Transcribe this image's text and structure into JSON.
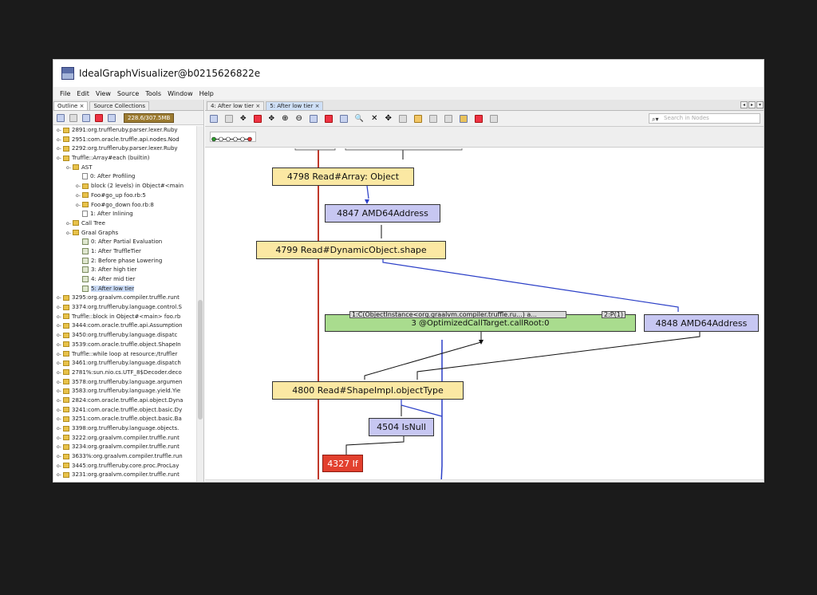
{
  "window": {
    "title": "IdealGraphVisualizer@b0215626822e"
  },
  "menu": [
    "File",
    "Edit",
    "View",
    "Source",
    "Tools",
    "Window",
    "Help"
  ],
  "left_tabs": [
    {
      "label": "Outline",
      "closable": true
    },
    {
      "label": "Source Collections",
      "closable": false
    }
  ],
  "memory": "228.6/307.5MB",
  "tree": [
    {
      "indent": 0,
      "exp": "o-",
      "icon": "folder",
      "label": "2891:org.truffleruby.parser.lexer.Ruby"
    },
    {
      "indent": 0,
      "exp": "o-",
      "icon": "folder",
      "label": "2951:com.oracle.truffle.api.nodes.Nod"
    },
    {
      "indent": 0,
      "exp": "o-",
      "icon": "folder",
      "label": "2292:org.truffleruby.parser.lexer.Ruby"
    },
    {
      "indent": 0,
      "exp": "o-",
      "icon": "folder",
      "label": "Truffle::Array#each (builtin)"
    },
    {
      "indent": 1,
      "exp": "o-",
      "icon": "folder",
      "label": "AST"
    },
    {
      "indent": 2,
      "exp": "",
      "icon": "page",
      "label": "0: After Profiling"
    },
    {
      "indent": 2,
      "exp": "o-",
      "icon": "folder",
      "label": "block (2 levels) in Object#<main"
    },
    {
      "indent": 2,
      "exp": "o-",
      "icon": "folder",
      "label": "Foo#go_up foo.rb:5"
    },
    {
      "indent": 2,
      "exp": "o-",
      "icon": "folder",
      "label": "Foo#go_down foo.rb:8"
    },
    {
      "indent": 2,
      "exp": "",
      "icon": "page",
      "label": "1: After Inlining"
    },
    {
      "indent": 1,
      "exp": "o-",
      "icon": "folder",
      "label": "Call Tree"
    },
    {
      "indent": 1,
      "exp": "o-",
      "icon": "folder",
      "label": "Graal Graphs"
    },
    {
      "indent": 2,
      "exp": "",
      "icon": "graph",
      "label": "0: After Partial Evaluation"
    },
    {
      "indent": 2,
      "exp": "",
      "icon": "graph",
      "label": "1: After TruffleTier"
    },
    {
      "indent": 2,
      "exp": "",
      "icon": "graph",
      "label": "2: Before phase Lowering"
    },
    {
      "indent": 2,
      "exp": "",
      "icon": "graph",
      "label": "3: After high tier"
    },
    {
      "indent": 2,
      "exp": "",
      "icon": "graph",
      "label": "4: After mid tier"
    },
    {
      "indent": 2,
      "exp": "",
      "icon": "graph",
      "label": "5: After low tier",
      "selected": true
    },
    {
      "indent": 0,
      "exp": "o-",
      "icon": "folder",
      "label": "3295:org.graalvm.compiler.truffle.runt"
    },
    {
      "indent": 0,
      "exp": "o-",
      "icon": "folder",
      "label": "3374:org.truffleruby.language.control.S"
    },
    {
      "indent": 0,
      "exp": "o-",
      "icon": "folder",
      "label": "Truffle::block in Object#<main> foo.rb"
    },
    {
      "indent": 0,
      "exp": "o-",
      "icon": "folder",
      "label": "3444:com.oracle.truffle.api.Assumption"
    },
    {
      "indent": 0,
      "exp": "o-",
      "icon": "folder",
      "label": "3450:org.truffleruby.language.dispatc"
    },
    {
      "indent": 0,
      "exp": "o-",
      "icon": "folder",
      "label": "3539:com.oracle.truffle.object.ShapeIn"
    },
    {
      "indent": 0,
      "exp": "o-",
      "icon": "folder",
      "label": "Truffle::while loop at resource:/truffler"
    },
    {
      "indent": 0,
      "exp": "o-",
      "icon": "folder",
      "label": "3461:org.truffleruby.language.dispatch"
    },
    {
      "indent": 0,
      "exp": "o-",
      "icon": "folder",
      "label": "2781%:sun.nio.cs.UTF_8$Decoder.deco"
    },
    {
      "indent": 0,
      "exp": "o-",
      "icon": "folder",
      "label": "3578:org.truffleruby.language.argumen"
    },
    {
      "indent": 0,
      "exp": "o-",
      "icon": "folder",
      "label": "3583:org.truffleruby.language.yield.Yie"
    },
    {
      "indent": 0,
      "exp": "o-",
      "icon": "folder",
      "label": "2824:com.oracle.truffle.api.object.Dyna"
    },
    {
      "indent": 0,
      "exp": "o-",
      "icon": "folder",
      "label": "3241:com.oracle.truffle.object.basic.Dy"
    },
    {
      "indent": 0,
      "exp": "o-",
      "icon": "folder",
      "label": "3251:com.oracle.truffle.object.basic.Ba"
    },
    {
      "indent": 0,
      "exp": "o-",
      "icon": "folder",
      "label": "3398:org.truffleruby.language.objects."
    },
    {
      "indent": 0,
      "exp": "o-",
      "icon": "folder",
      "label": "3222:org.graalvm.compiler.truffle.runt"
    },
    {
      "indent": 0,
      "exp": "o-",
      "icon": "folder",
      "label": "3234:org.graalvm.compiler.truffle.runt"
    },
    {
      "indent": 0,
      "exp": "o-",
      "icon": "folder",
      "label": "3633%:org.graalvm.compiler.truffle.run"
    },
    {
      "indent": 0,
      "exp": "o-",
      "icon": "folder",
      "label": "3445:org.truffleruby.core.proc.ProcLay"
    },
    {
      "indent": 0,
      "exp": "o-",
      "icon": "folder",
      "label": "3231:org.graalvm.compiler.truffle.runt"
    }
  ],
  "graph_tabs": [
    {
      "label": "4: After low tier",
      "active": false
    },
    {
      "label": "5: After low tier",
      "active": true
    }
  ],
  "search_placeholder": "Search in Nodes",
  "nodes": [
    {
      "id": "n4798",
      "label": "4798 Read#Array: Object",
      "color": "yellow"
    },
    {
      "id": "n4847",
      "label": "4847 AMD64Address",
      "color": "blue"
    },
    {
      "id": "n4799",
      "label": "4799 Read#DynamicObject.shape",
      "color": "yellow"
    },
    {
      "id": "n3",
      "label": "3 @OptimizedCallTarget.callRoot:0",
      "color": "green"
    },
    {
      "id": "n4848",
      "label": "4848 AMD64Address",
      "color": "blue"
    },
    {
      "id": "n4800",
      "label": "4800 Read#ShapeImpl.objectType",
      "color": "yellow"
    },
    {
      "id": "n4504",
      "label": "4504 IsNull",
      "color": "blue"
    },
    {
      "id": "n4327",
      "label": "4327 If",
      "color": "red"
    }
  ],
  "call_inputs": {
    "left": "1:C(ObjectInstance<org.graalvm.compiler.truffle.ru...) a...",
    "right": "2:P(1)"
  }
}
